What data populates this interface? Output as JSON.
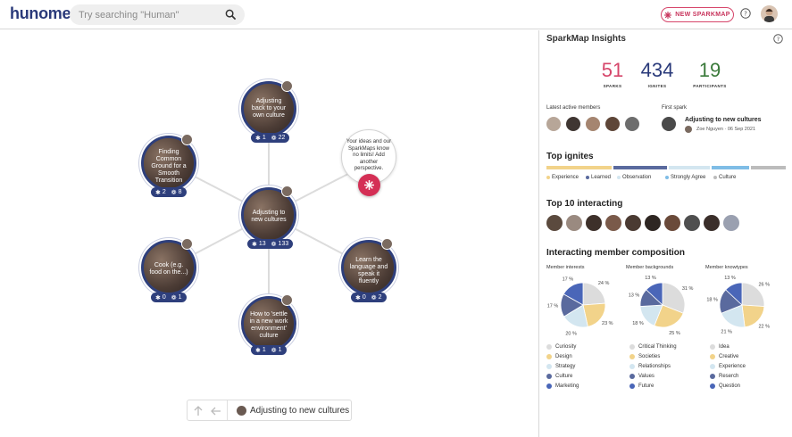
{
  "header": {
    "logo": "hunome",
    "search_placeholder": "Try searching \"Human\"",
    "new_button": "NEW SPARKMAP",
    "search_icon": "magnifier-icon",
    "help_icon": "question-circle-icon"
  },
  "colors": {
    "brand_blue": "#2e3f7c",
    "accent_red": "#d42f55",
    "sparks_pink": "#d6456a",
    "ignites_blue": "#2a3a7a",
    "participants_green": "#3a7a3a"
  },
  "map": {
    "nodes": [
      {
        "label": "Adjusting back to your own culture",
        "sparks": "1",
        "ignites": "22"
      },
      {
        "label": "Finding Common Ground for a Smooth Transition",
        "sparks": "2",
        "ignites": "8"
      },
      {
        "label": "Adjusting to new cultures",
        "sparks": "13",
        "ignites": "133"
      },
      {
        "label": "Cook (e.g. food on the...)",
        "sparks": "0",
        "ignites": "1"
      },
      {
        "label": "Learn the language and speak it fluently",
        "sparks": "0",
        "ignites": "2"
      },
      {
        "label": "How to 'settle in a new work environment' culture",
        "sparks": "1",
        "ignites": "1"
      }
    ],
    "invite_text": "Your ideas and our SparkMaps know no limits! Add another perspective.",
    "add_spark_icon": "spark-icon",
    "current": "Adjusting to new cultures",
    "up_icon": "arrow-up-icon",
    "back_icon": "arrow-left-icon"
  },
  "insights": {
    "title": "SparkMap Insights",
    "stats": [
      {
        "value": "51",
        "label": "SPARKS"
      },
      {
        "value": "434",
        "label": "IGNITES"
      },
      {
        "value": "19",
        "label": "PARTICIPANTS"
      }
    ],
    "latest_active_label": "Latest active members",
    "first_spark_label": "First spark",
    "first_spark_title": "Adjusting to new cultures",
    "first_spark_meta": "Zoe Nguyen · 06 Sep 2021",
    "top_ignites_title": "Top ignites",
    "top_ignites": [
      {
        "name": "Experience",
        "share": 0.28,
        "color": "#f2d38a"
      },
      {
        "name": "Learned",
        "share": 0.23,
        "color": "#5a6a9e"
      },
      {
        "name": "Observation",
        "share": 0.18,
        "color": "#d3e6f0"
      },
      {
        "name": "Strongly Agree",
        "share": 0.16,
        "color": "#7fbde6"
      },
      {
        "name": "Culture",
        "share": 0.15,
        "color": "#bcbcbc"
      }
    ],
    "top10_title": "Top 10 interacting",
    "composition_title": "Interacting member composition",
    "pies": [
      {
        "title": "Member interests",
        "slices": [
          {
            "name": "Curiosity",
            "value": 24,
            "color": "#dcdcdc"
          },
          {
            "name": "Design",
            "value": 23,
            "color": "#f2d38a"
          },
          {
            "name": "Strategy",
            "value": 20,
            "color": "#d3e6f0"
          },
          {
            "name": "Culture",
            "value": 17,
            "color": "#5a6a9e"
          },
          {
            "name": "Marketing",
            "value": 17,
            "color": "#4a66b8"
          }
        ],
        "labels": [
          "24 %",
          "23 %",
          "20 %",
          "17 %",
          "17 %"
        ]
      },
      {
        "title": "Member backgrounds",
        "slices": [
          {
            "name": "Critical Thinking",
            "value": 31,
            "color": "#dcdcdc"
          },
          {
            "name": "Societies",
            "value": 25,
            "color": "#f2d38a"
          },
          {
            "name": "Relationships",
            "value": 18,
            "color": "#d3e6f0"
          },
          {
            "name": "Values",
            "value": 13,
            "color": "#5a6a9e"
          },
          {
            "name": "Future",
            "value": 13,
            "color": "#4a66b8"
          }
        ],
        "labels": [
          "31 %",
          "25 %",
          "18 %",
          "13 %",
          "13 %"
        ]
      },
      {
        "title": "Member knowtypes",
        "slices": [
          {
            "name": "Idea",
            "value": 26,
            "color": "#dcdcdc"
          },
          {
            "name": "Creative",
            "value": 22,
            "color": "#f2d38a"
          },
          {
            "name": "Experience",
            "value": 21,
            "color": "#d3e6f0"
          },
          {
            "name": "Reserch",
            "value": 18,
            "color": "#5a6a9e"
          },
          {
            "name": "Question",
            "value": 13,
            "color": "#4a66b8"
          }
        ],
        "labels": [
          "26 %",
          "22 %",
          "21 %",
          "18 %",
          "13 %"
        ]
      }
    ]
  }
}
